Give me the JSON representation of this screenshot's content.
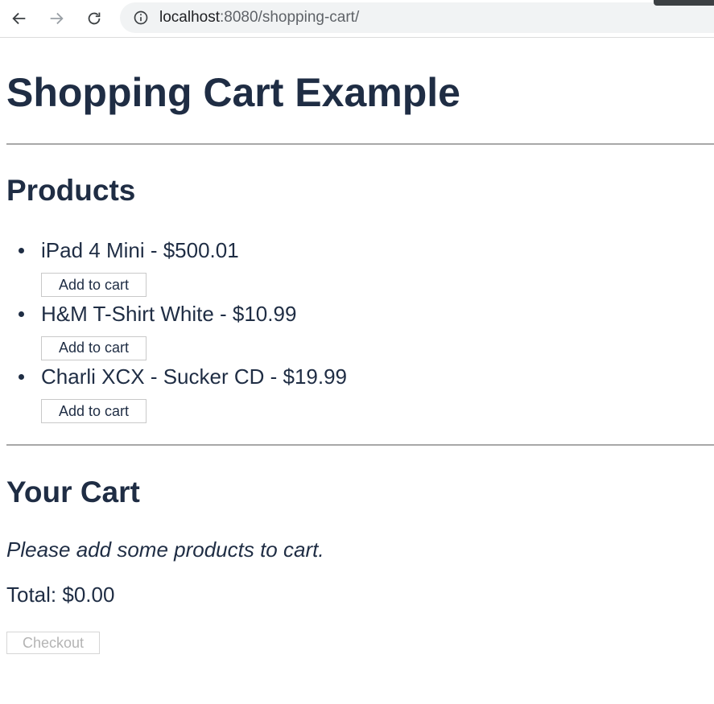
{
  "browser": {
    "url_host": "localhost",
    "url_path": ":8080/shopping-cart/",
    "back_icon": "arrow-left-icon",
    "forward_icon": "arrow-right-icon",
    "reload_icon": "reload-icon",
    "info_icon": "info-circle-icon"
  },
  "page": {
    "title": "Shopping Cart Example"
  },
  "products": {
    "heading": "Products",
    "add_label": "Add to cart",
    "items": [
      {
        "name": "iPad 4 Mini",
        "price": "$500.01",
        "display": "iPad 4 Mini - $500.01"
      },
      {
        "name": "H&M T-Shirt White",
        "price": "$10.99",
        "display": "H&M T-Shirt White - $10.99"
      },
      {
        "name": "Charli XCX - Sucker CD",
        "price": "$19.99",
        "display": "Charli XCX - Sucker CD - $19.99"
      }
    ]
  },
  "cart": {
    "heading": "Your Cart",
    "empty_message": "Please add some products to cart.",
    "total_text": "Total: $0.00",
    "checkout_label": "Checkout",
    "checkout_disabled": true
  },
  "colors": {
    "text": "#1f2d44",
    "rule": "#a8a8a8",
    "button_border": "#c9c9c9",
    "disabled_text": "#b4b4b4"
  }
}
